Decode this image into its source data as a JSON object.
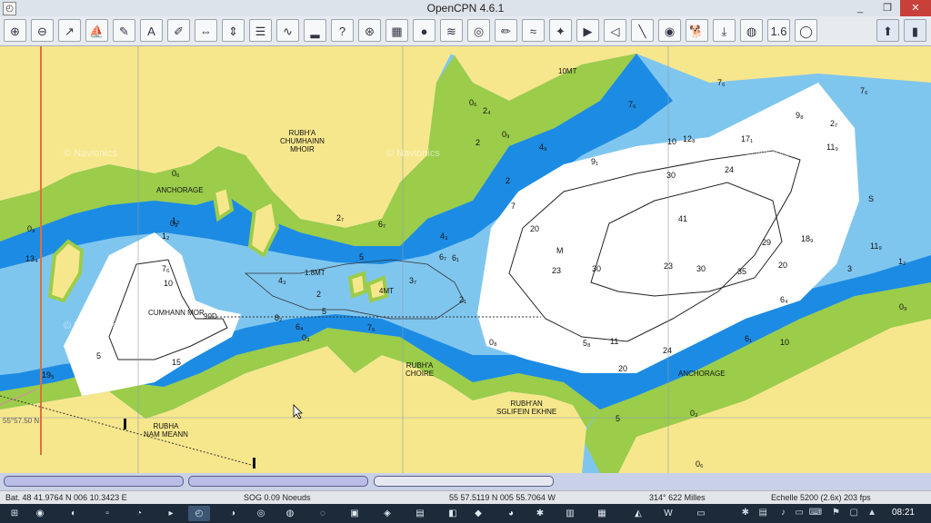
{
  "window": {
    "title": "OpenCPN 4.6.1",
    "app_icon": "opencpn-icon",
    "controls": [
      "_",
      "❐",
      "✕"
    ]
  },
  "toolbar": {
    "buttons": [
      {
        "name": "zoom-in-icon",
        "glyph": "⊕"
      },
      {
        "name": "zoom-out-icon",
        "glyph": "⊖"
      },
      {
        "name": "route-icon",
        "glyph": "↗"
      },
      {
        "name": "ship-icon",
        "glyph": "⛵"
      },
      {
        "name": "measure-icon",
        "glyph": "✎"
      },
      {
        "name": "text-mark-icon",
        "glyph": "A"
      },
      {
        "name": "draw-icon",
        "glyph": "✐"
      },
      {
        "name": "distance-icon",
        "glyph": "⇔"
      },
      {
        "name": "track-icon",
        "glyph": "⇕"
      },
      {
        "name": "route-manager-icon",
        "glyph": "☰"
      },
      {
        "name": "tide-icon",
        "glyph": "∿"
      },
      {
        "name": "depth-icon",
        "glyph": "▂"
      },
      {
        "name": "help-icon",
        "glyph": "?"
      },
      {
        "name": "target-icon",
        "glyph": "⊛"
      },
      {
        "name": "palette-icon",
        "glyph": "▦"
      },
      {
        "name": "layers-icon",
        "glyph": "●"
      },
      {
        "name": "sounding-icon",
        "glyph": "≋"
      },
      {
        "name": "google-earth-icon",
        "glyph": "◎"
      },
      {
        "name": "draw-route-icon",
        "glyph": "✏"
      },
      {
        "name": "wave-icon",
        "glyph": "≈"
      },
      {
        "name": "compass-icon",
        "glyph": "✦"
      },
      {
        "name": "nav-icon",
        "glyph": "▶"
      },
      {
        "name": "waypoint-icon",
        "glyph": "◁"
      },
      {
        "name": "ruler-icon",
        "glyph": "╲"
      },
      {
        "name": "record-icon",
        "glyph": "◉"
      },
      {
        "name": "dog-icon",
        "glyph": "🐕"
      },
      {
        "name": "download-icon",
        "glyph": "⤓"
      },
      {
        "name": "globe-icon",
        "glyph": "◍"
      },
      {
        "name": "zoom-level-icon",
        "glyph": "1.6"
      },
      {
        "name": "lifebuoy-icon",
        "glyph": "◯"
      },
      {
        "name": "compass-north-icon",
        "glyph": "⬆"
      },
      {
        "name": "signal-icon",
        "glyph": "▮"
      }
    ]
  },
  "chart": {
    "land_color": "#f7e78c",
    "intertidal_color": "#9bcc4a",
    "shallow_color": "#1c8be3",
    "mid_color": "#7fc6ef",
    "deep_color": "#ffffff",
    "place_labels": [
      {
        "id": "rubha-chumhainn",
        "text": "RUBH'A\nCHUMHAINN\nMHOIR"
      },
      {
        "id": "anchorage-west",
        "text": "ANCHORAGE"
      },
      {
        "id": "cumhann-mor",
        "text": "CUMHANN MOR"
      },
      {
        "id": "rubha-choire",
        "text": "RUBH'A\nCHOIRE"
      },
      {
        "id": "rubha-sglifein",
        "text": "RUBH'AN\nSGLIFEIN EKHNE"
      },
      {
        "id": "rubha-nam-meann",
        "text": "RUBHA\nNAM MEANN"
      },
      {
        "id": "anchorage-east",
        "text": "ANCHORAGE"
      },
      {
        "id": "lat-label",
        "text": "55°57.50 N"
      },
      {
        "id": "mark-10mt",
        "text": "10MT"
      },
      {
        "id": "mark-18mt",
        "text": "1.8MT"
      },
      {
        "id": "mark-4mt",
        "text": "4MT"
      },
      {
        "id": "mark-900",
        "text": "90D"
      }
    ],
    "soundings": [
      "0₆",
      "2",
      "0₉",
      "4₉",
      "9₁",
      "10",
      "12₈",
      "17₁",
      "24",
      "30",
      "11₉",
      "20",
      "41",
      "29",
      "18₉",
      "23",
      "30",
      "23",
      "30",
      "35",
      "20",
      "M",
      "6₄",
      "3",
      "1₂",
      "7₆",
      "6₇",
      "9₈",
      "11₉",
      "7₆",
      "2₇",
      "S",
      "7₆",
      "2₇",
      "4₃",
      "6₇",
      "5",
      "3₇",
      "2₁",
      "0₈",
      "5₈",
      "11",
      "24",
      "20",
      "6₁",
      "10",
      "5",
      "0₃",
      "0₆",
      "0₉",
      "0₉",
      "1₂",
      "7₆",
      "10",
      "5",
      "15",
      "19₅",
      "13₄",
      "8₂",
      "6₄",
      "0₃",
      "7₆",
      "5",
      "2",
      "4₃",
      "6₁",
      "2₄",
      "2",
      "7",
      "0₆",
      "0₉",
      "1₂"
    ],
    "watermark": "© Navionics"
  },
  "scrollbars": [
    "",
    "",
    ""
  ],
  "status": {
    "position": "Bat. 48 41.9764 N   006 10.3423 E",
    "sog": "SOG 0.09 Noeuds",
    "cursor": "55 57.5119 N   005 55.7064 W",
    "bearing": "314°   622 Milles",
    "scale": "Echelle 5200 (2.6x)   203 fps"
  },
  "taskbar": {
    "time": "08:21",
    "apps": [
      "start-icon",
      "firefox-icon",
      "explorer-icon",
      "file-icon",
      "edge-icon",
      "vlc-icon",
      "opencpn-icon",
      "browser-icon",
      "chrome-icon",
      "globe-icon",
      "map-icon",
      "folder-icon",
      "gpsicon",
      "disk-icon",
      "paint-icon",
      "torrent-icon",
      "chromium-icon",
      "settings-icon",
      "explorer-folder-icon",
      "folder-icon",
      "acrobat-icon",
      "word-icon",
      "terminal-icon"
    ]
  }
}
